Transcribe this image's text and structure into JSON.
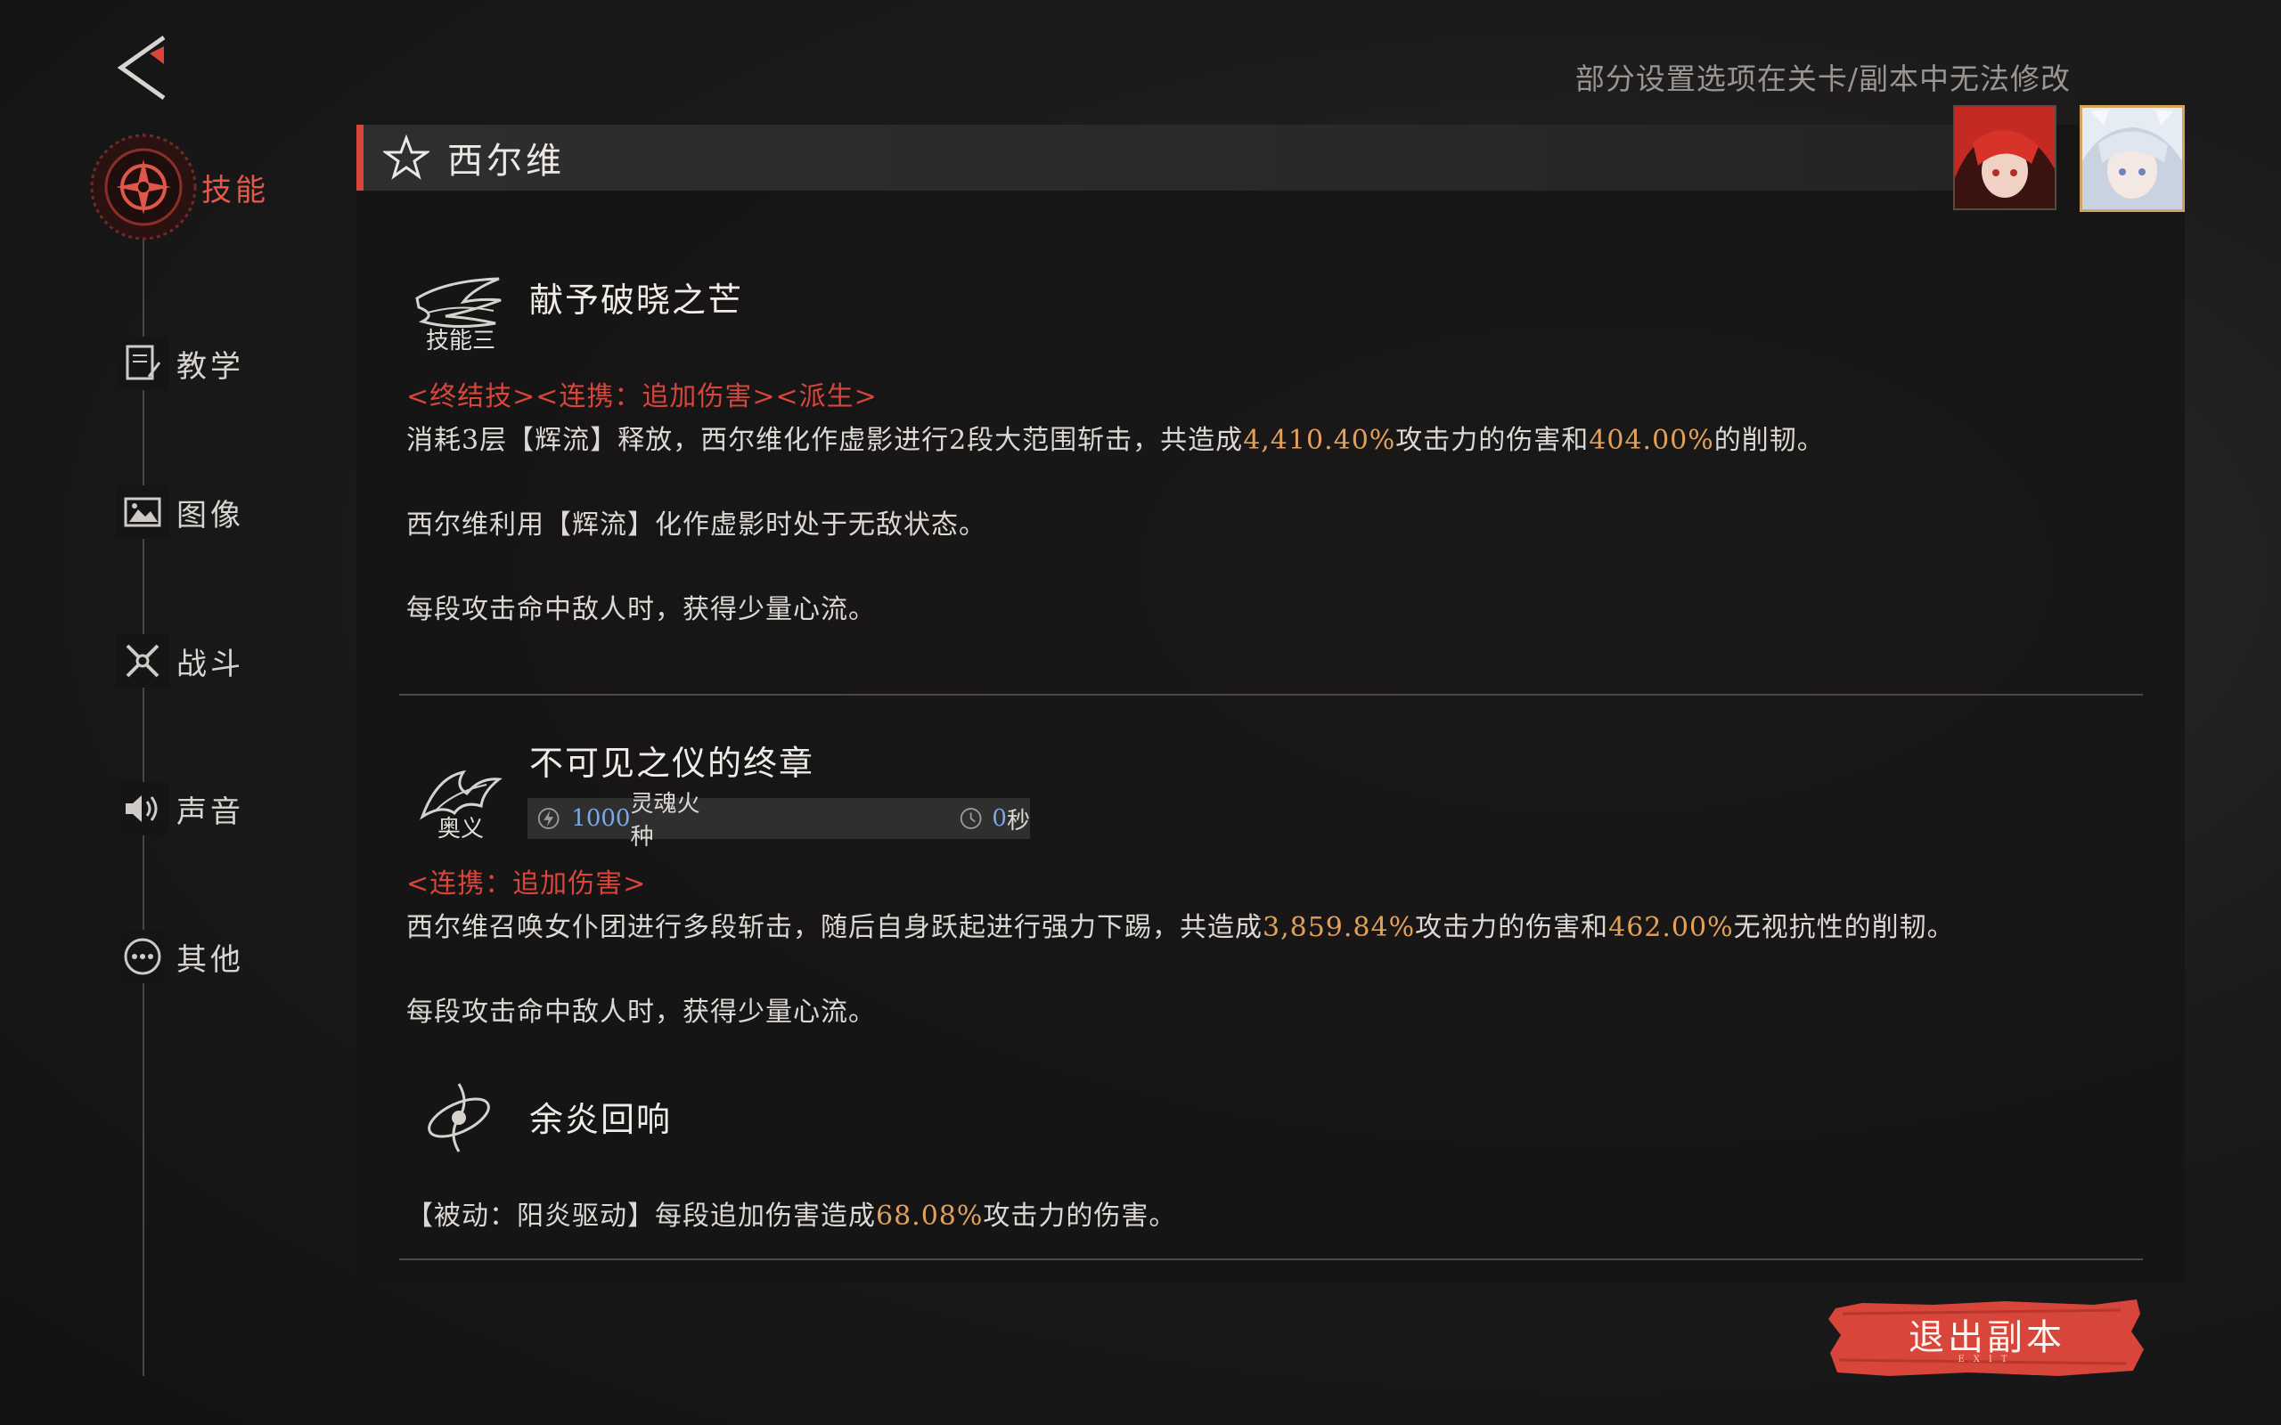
{
  "notice": "部分设置选项在关卡/副本中无法修改",
  "sidebar": {
    "items": [
      {
        "label": "技能",
        "active": true,
        "icon": "compass-emblem-icon"
      },
      {
        "label": "教学",
        "icon": "notebook-icon"
      },
      {
        "label": "图像",
        "icon": "image-icon"
      },
      {
        "label": "战斗",
        "icon": "crossed-swords-icon"
      },
      {
        "label": "声音",
        "icon": "speaker-icon"
      },
      {
        "label": "其他",
        "icon": "more-dots-icon"
      }
    ]
  },
  "character": {
    "name": "西尔维"
  },
  "skills": [
    {
      "title": "献予破晓之芒",
      "tag": "技能三",
      "type_line": "<终结技><连携：追加伤害><派生>",
      "desc1_a": "消耗3层【辉流】释放，西尔维化作虚影进行2段大范围斩击，共造成",
      "desc1_v1": "4,410.40%",
      "desc1_b": "攻击力的伤害和",
      "desc1_v2": "404.00%",
      "desc1_c": "的削韧。",
      "desc2": "西尔维利用【辉流】化作虚影时处于无敌状态。",
      "desc3": "每段攻击命中敌人时，获得少量心流。"
    },
    {
      "title": "不可见之仪的终章",
      "tag": "奥义",
      "cost_value": "1000",
      "cost_unit": "灵魂火种",
      "cooldown_value": "0",
      "cooldown_unit": "秒",
      "type_line": "<连携：追加伤害>",
      "desc1_a": "西尔维召唤女仆团进行多段斩击，随后自身跃起进行强力下踢，共造成",
      "desc1_v1": "3,859.84%",
      "desc1_b": "攻击力的伤害和",
      "desc1_v2": "462.00%",
      "desc1_c": "无视抗性的削韧。",
      "desc2": "每段攻击命中敌人时，获得少量心流。"
    },
    {
      "title": "余炎回响",
      "desc1_a": "【被动：阳炎驱动】每段追加伤害造成",
      "desc1_v1": "68.08%",
      "desc1_b": "攻击力的伤害。"
    }
  ],
  "exit_button": {
    "label": "退出副本",
    "sub": "EXIT"
  },
  "colors": {
    "accent_red": "#d9453b",
    "highlight_orange": "#e2a15a",
    "cost_blue": "#7ea8e4"
  }
}
